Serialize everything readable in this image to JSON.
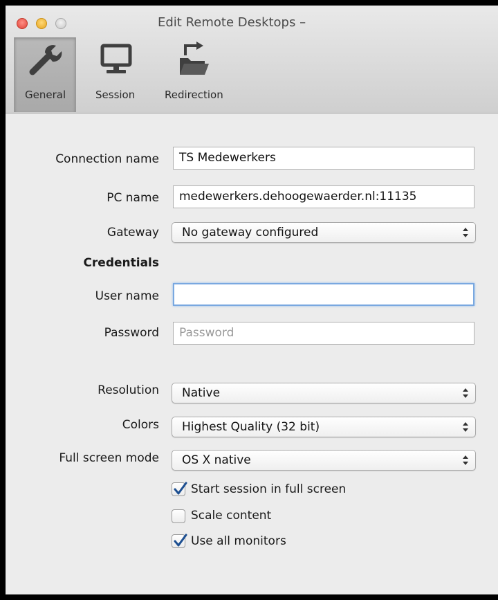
{
  "window": {
    "title": "Edit Remote Desktops –"
  },
  "toolbar": {
    "items": [
      {
        "label": "General",
        "icon": "wrench-icon",
        "selected": true
      },
      {
        "label": "Session",
        "icon": "monitor-icon",
        "selected": false
      },
      {
        "label": "Redirection",
        "icon": "folder-redirect-icon",
        "selected": false
      }
    ]
  },
  "form": {
    "connection_name": {
      "label": "Connection name",
      "value": "TS Medewerkers"
    },
    "pc_name": {
      "label": "PC name",
      "value": "medewerkers.dehoogewaerder.nl:11135"
    },
    "gateway": {
      "label": "Gateway",
      "value": "No gateway configured"
    },
    "credentials_heading": "Credentials",
    "user_name": {
      "label": "User name",
      "value": ""
    },
    "password": {
      "label": "Password",
      "placeholder": "Password"
    },
    "resolution": {
      "label": "Resolution",
      "value": "Native"
    },
    "colors": {
      "label": "Colors",
      "value": "Highest Quality (32 bit)"
    },
    "full_screen_mode": {
      "label": "Full screen mode",
      "value": "OS X native"
    },
    "checkboxes": [
      {
        "label": "Start session in full screen",
        "checked": true
      },
      {
        "label": "Scale content",
        "checked": false
      },
      {
        "label": "Use all monitors",
        "checked": true
      }
    ]
  },
  "colors": {
    "focus_ring": "#79a8e0",
    "checkmark": "#1d4f91"
  }
}
